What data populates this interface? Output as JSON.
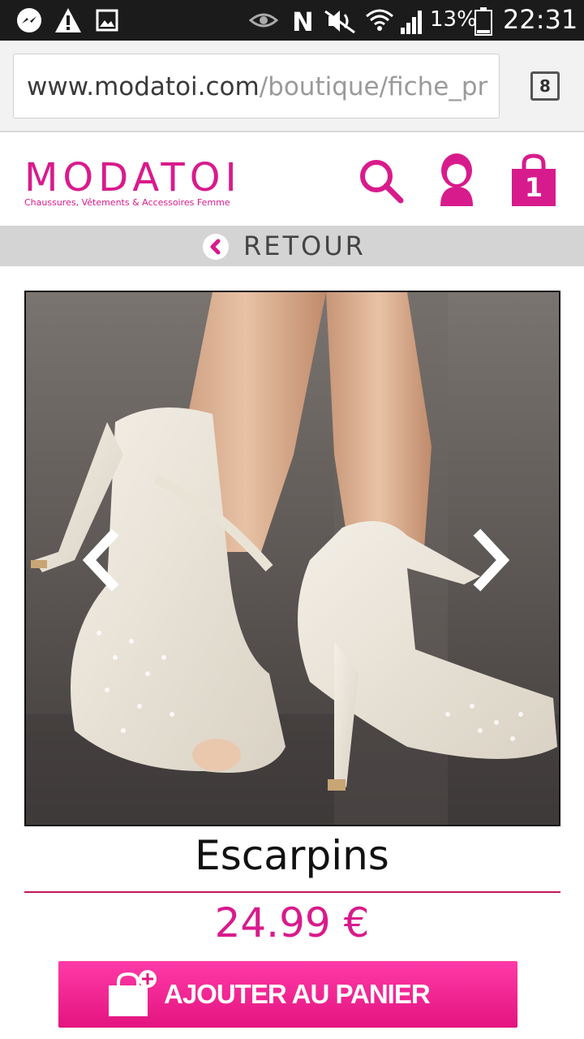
{
  "status_bar": {
    "icons": [
      "messenger-icon",
      "warning-icon",
      "image-icon",
      "eye-icon",
      "nfc-icon",
      "mute-icon",
      "wifi-icon",
      "signal-icon",
      "battery-icon"
    ],
    "battery": "13%",
    "time": "22:31"
  },
  "browser": {
    "url_host": "www.modatoi.com",
    "url_path": "/boutique/fiche_pr",
    "tab_count": "8"
  },
  "site": {
    "logo": "MODATOI",
    "tagline": "Chaussures, Vêtements & Accessoires Femme",
    "brand_color": "#d81b8c",
    "cart_count": "1",
    "header_icons": [
      "search-icon",
      "account-icon",
      "cart-icon"
    ]
  },
  "nav": {
    "back_label": "RETOUR"
  },
  "product": {
    "image_alt": "Escarpins",
    "title": "Escarpins",
    "price": "24.99 €",
    "add_to_cart_label": "AJOUTER AU PANIER"
  }
}
